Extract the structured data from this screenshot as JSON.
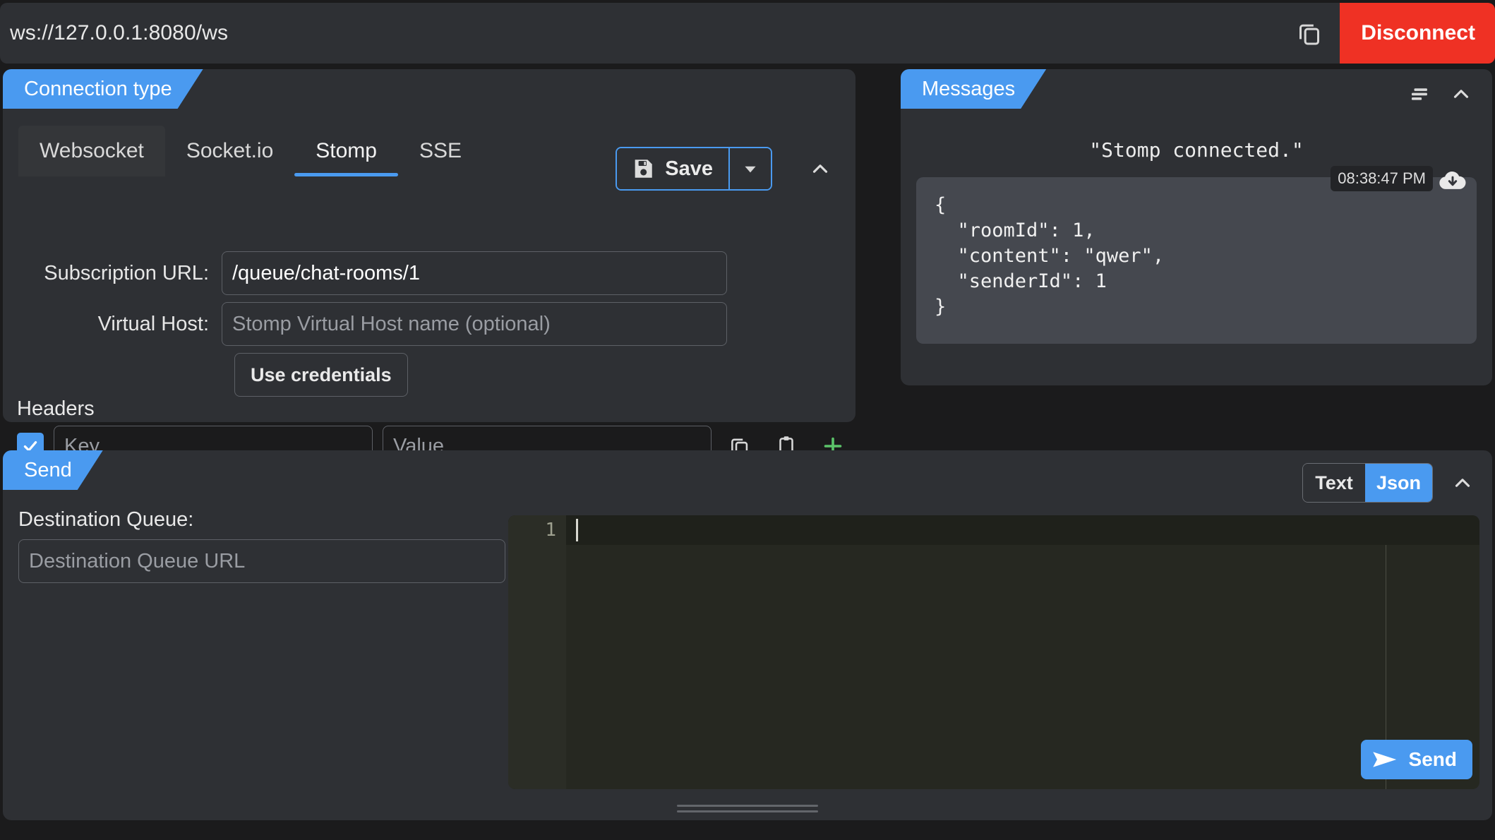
{
  "topbar": {
    "url": "ws://127.0.0.1:8080/ws",
    "copy_icon": "copy-icon",
    "disconnect_label": "Disconnect"
  },
  "connection": {
    "panel_title": "Connection type",
    "tabs": [
      {
        "label": "Websocket",
        "active": false
      },
      {
        "label": "Socket.io",
        "active": false
      },
      {
        "label": "Stomp",
        "active": true
      },
      {
        "label": "SSE",
        "active": false
      }
    ],
    "save_label": "Save",
    "save_icon": "floppy-disk-icon",
    "save_caret_icon": "chevron-down-icon",
    "collapse_icon": "chevron-up-icon",
    "subscription_url_label": "Subscription URL:",
    "subscription_url_value": "/queue/chat-rooms/1",
    "virtual_host_label": "Virtual Host:",
    "virtual_host_placeholder": "Stomp Virtual Host name (optional)",
    "use_credentials_label": "Use credentials",
    "headers_title": "Headers",
    "header_key_placeholder": "Key",
    "header_value_placeholder": "Value",
    "header_copy_icon": "copy-icon",
    "header_paste_icon": "paste-icon",
    "header_add_icon": "plus-icon"
  },
  "messages": {
    "panel_title": "Messages",
    "filter_icon": "align-lines-icon",
    "collapse_icon": "chevron-up-icon",
    "status_text": "\"Stomp connected.\"",
    "entries": [
      {
        "time": "08:38:47 PM",
        "download_icon": "cloud-download-icon",
        "body": "{\n  \"roomId\": 1,\n  \"content\": \"qwer\",\n  \"senderId\": 1\n}"
      }
    ]
  },
  "send": {
    "panel_title": "Send",
    "format_options": [
      {
        "label": "Text",
        "active": false
      },
      {
        "label": "Json",
        "active": true
      }
    ],
    "collapse_icon": "chevron-up-icon",
    "destination_label": "Destination Queue:",
    "destination_placeholder": "Destination Queue URL",
    "editor_line_number": "1",
    "editor_value": "",
    "send_label": "Send",
    "send_icon": "paper-plane-icon"
  },
  "colors": {
    "accent": "#4a9af0",
    "danger": "#ef3124",
    "panel_bg": "#2e3034",
    "page_bg": "#1b1b1c",
    "editor_bg": "#262821",
    "bubble_bg": "#45484f",
    "add_green": "#5cc46a"
  }
}
